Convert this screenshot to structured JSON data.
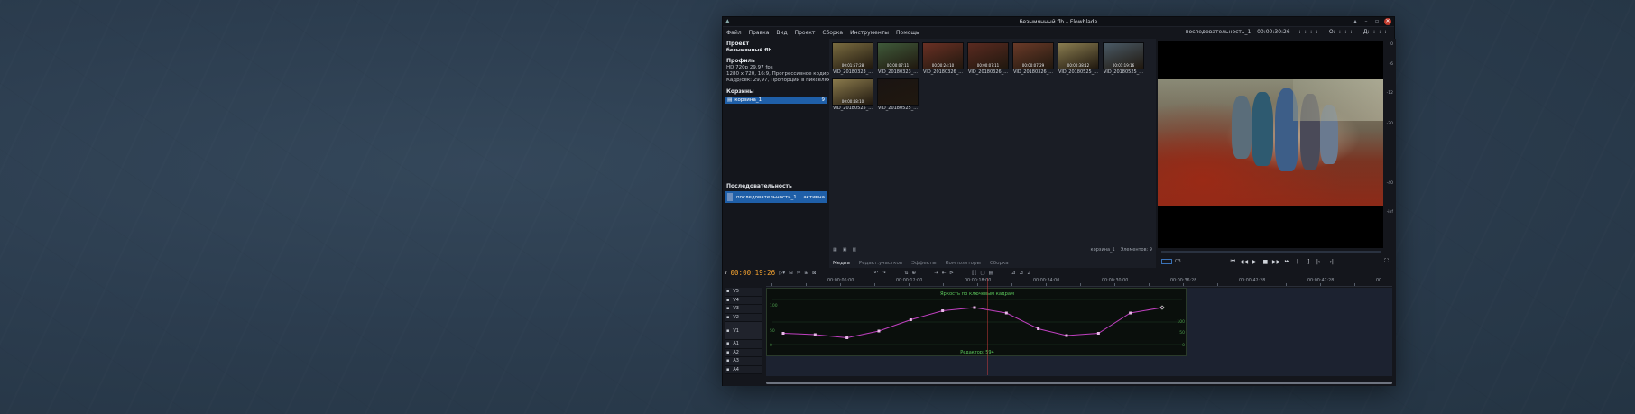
{
  "window": {
    "title": "безымянный.flb – Flowblade",
    "controls": [
      "▴",
      "–",
      "▫",
      "✕"
    ]
  },
  "menu": [
    "Файл",
    "Правка",
    "Вид",
    "Проект",
    "Сборка",
    "Инструменты",
    "Помощь"
  ],
  "top_timecode": {
    "sequence": "последовательность_1 – 00:00:30:26",
    "in": "I:--:--:--:--",
    "out": "O:--:--:--:--",
    "dur": "Д:--:--:--:--"
  },
  "project": {
    "heading": "Проект",
    "name": "безымянный.flb",
    "profile_heading": "Профиль",
    "profile_line1": "HD 720p 29.97 fps",
    "profile_line2": "1280 x 720, 16:9, Прогрессивное кодирование",
    "profile_line3": "Кадр/сек: 29,97, Пропорции в пикселях: 1:00",
    "bins_heading": "Корзины",
    "bin": {
      "name": "корзина_1",
      "count": "9"
    },
    "sequence_heading": "Последовательность",
    "sequence": {
      "name": "последовательность_1",
      "status": "активна"
    }
  },
  "media": {
    "items": [
      {
        "name": "VID_20180323_...",
        "tc": "00:01:57:28",
        "color": "#7a6c40"
      },
      {
        "name": "VID_20180323_...",
        "tc": "00:00:07:11",
        "color": "#3f5a3a"
      },
      {
        "name": "VID_20180326_...",
        "tc": "00:00:24:10",
        "color": "#6a3024"
      },
      {
        "name": "VID_20180326_...",
        "tc": "00:00:07:11",
        "color": "#5a2a20"
      },
      {
        "name": "VID_20180326_...",
        "tc": "00:00:07:29",
        "color": "#6a3a28"
      },
      {
        "name": "VID_20180525_...",
        "tc": "00:00:38:12",
        "color": "#8a7d50"
      },
      {
        "name": "VID_20180525_...",
        "tc": "00:01:19:16",
        "color": "#4a5a66"
      },
      {
        "name": "VID_20180525_...",
        "tc": "00:00:48:10",
        "color": "#8a7a4c"
      },
      {
        "name": "VID_20180525_...",
        "tc": "",
        "color": "#1a1412"
      }
    ],
    "footer_bin": "корзина_1",
    "footer_count": "Элементов: 9",
    "tabs": [
      "Медиа",
      "Редакт.участков",
      "Эффекты",
      "Композиторы",
      "Сборка"
    ]
  },
  "viewer": {
    "meter_labels": [
      "0",
      "-6",
      "-12",
      "-20",
      "-40",
      "-inf"
    ],
    "transport": [
      "⏮",
      "◀◀",
      "▶",
      "■",
      "▶▶",
      "⏭",
      "[",
      "]",
      "|←",
      "→|"
    ]
  },
  "timeline": {
    "timecode": "00:00:19:26",
    "ruler": [
      "00:00:06:00",
      "00:00:12:00",
      "00:00:18:00",
      "00:00:24:00",
      "00:00:30:00",
      "00:00:36:28",
      "00:00:42:28",
      "00:00:47:28",
      "00"
    ],
    "tracks": [
      "V5",
      "V4",
      "V3",
      "V2",
      "V1",
      "A1",
      "A2",
      "A3",
      "A4"
    ],
    "panel": {
      "title": "Яркость по ключевым кадрам",
      "footer": "Редактор: 594",
      "left_labels": [
        "100",
        "50",
        "0"
      ],
      "right_labels": [
        "100",
        "50",
        "0"
      ],
      "keyframe_values": [
        0.25,
        0.22,
        0.15,
        0.3,
        0.55,
        0.75,
        0.82,
        0.7,
        0.35,
        0.2,
        0.25,
        0.7,
        0.82
      ]
    }
  },
  "colors": {
    "accent": "#1f5fa8",
    "timecode": "#f0a030",
    "keyframe_line": "#c040c0",
    "panel_title": "#5cc85c"
  }
}
